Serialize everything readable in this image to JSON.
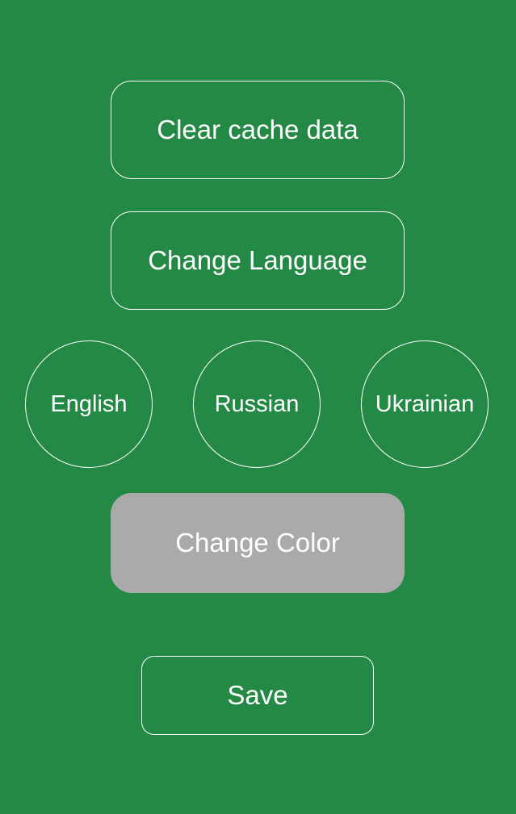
{
  "theme": {
    "background": "#238945",
    "foreground": "#ffffff",
    "disabled_button": "#aaaaaa"
  },
  "settings": {
    "clear_cache_label": "Clear cache data",
    "change_language_label": "Change Language",
    "languages": [
      {
        "label": "English"
      },
      {
        "label": "Russian"
      },
      {
        "label": "Ukrainian"
      }
    ],
    "change_color_label": "Change Color",
    "save_label": "Save"
  }
}
